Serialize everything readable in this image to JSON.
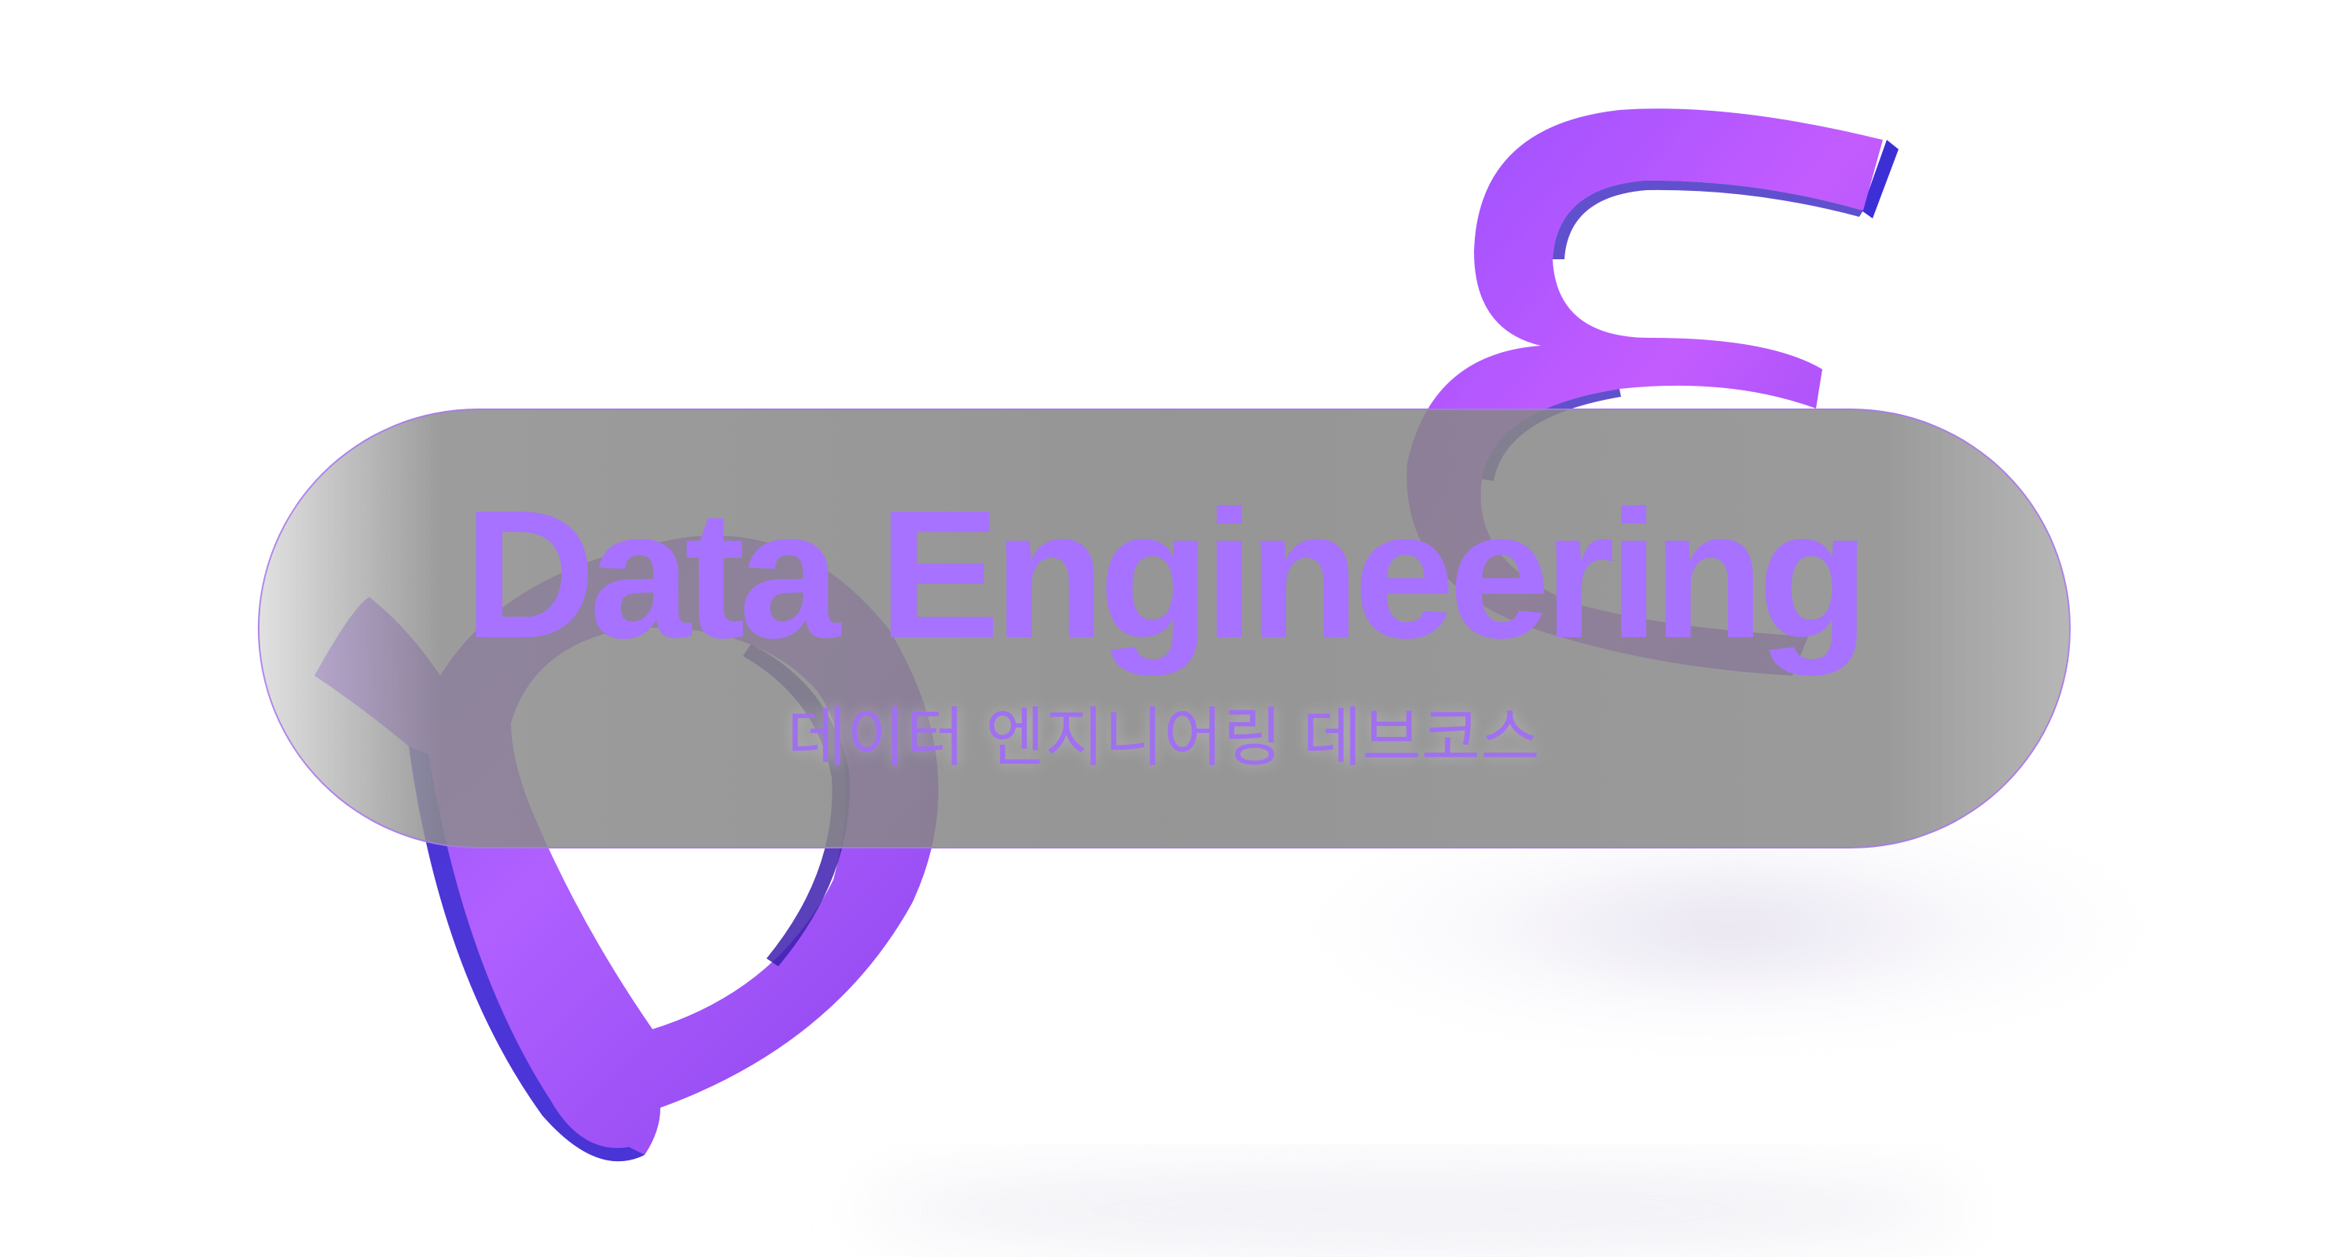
{
  "banner": {
    "title": "Data Engineering",
    "subtitle": "데이터 엔지니어링 데브코스"
  },
  "colors": {
    "accent": "#a772ff",
    "shape_main": "#9d4cff",
    "shape_dark": "#4a2ad8",
    "pill_fill": "#8a8a8a"
  },
  "decorations": {
    "shapes": [
      "purple-3d-letter-d-shape",
      "purple-3d-curl-shape"
    ]
  }
}
